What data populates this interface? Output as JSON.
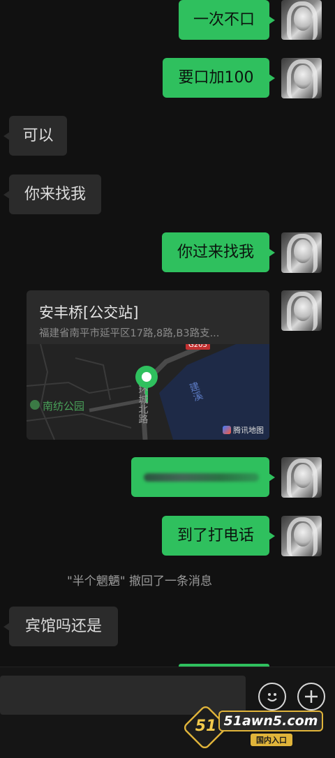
{
  "messages": {
    "m1": "一次不口",
    "m2": "要口加100",
    "m3": "可以",
    "m4": "你来找我",
    "m5": "你过来找我",
    "m6": "到了打电话",
    "m7": "宾馆吗还是"
  },
  "location": {
    "title": "安丰桥[公交站]",
    "address": "福建省南平市延平区17路,8路,B3路支...",
    "map_labels": {
      "road_badge": "G205",
      "park": "南纺公园",
      "river": "建溪",
      "street": "环城北路",
      "provider": "腾讯地图"
    }
  },
  "recall_notice": "\"半个魍魉\" 撤回了一条消息",
  "input": {
    "emoji_icon": "smile-icon",
    "plus_icon": "plus-icon"
  },
  "watermark": {
    "badge": "51",
    "domain": "51awn5.com",
    "subtitle": "国内入口"
  },
  "colors": {
    "outgoing_bubble": "#2fc05e",
    "incoming_bubble": "#2b2b2b",
    "background": "#111111"
  }
}
